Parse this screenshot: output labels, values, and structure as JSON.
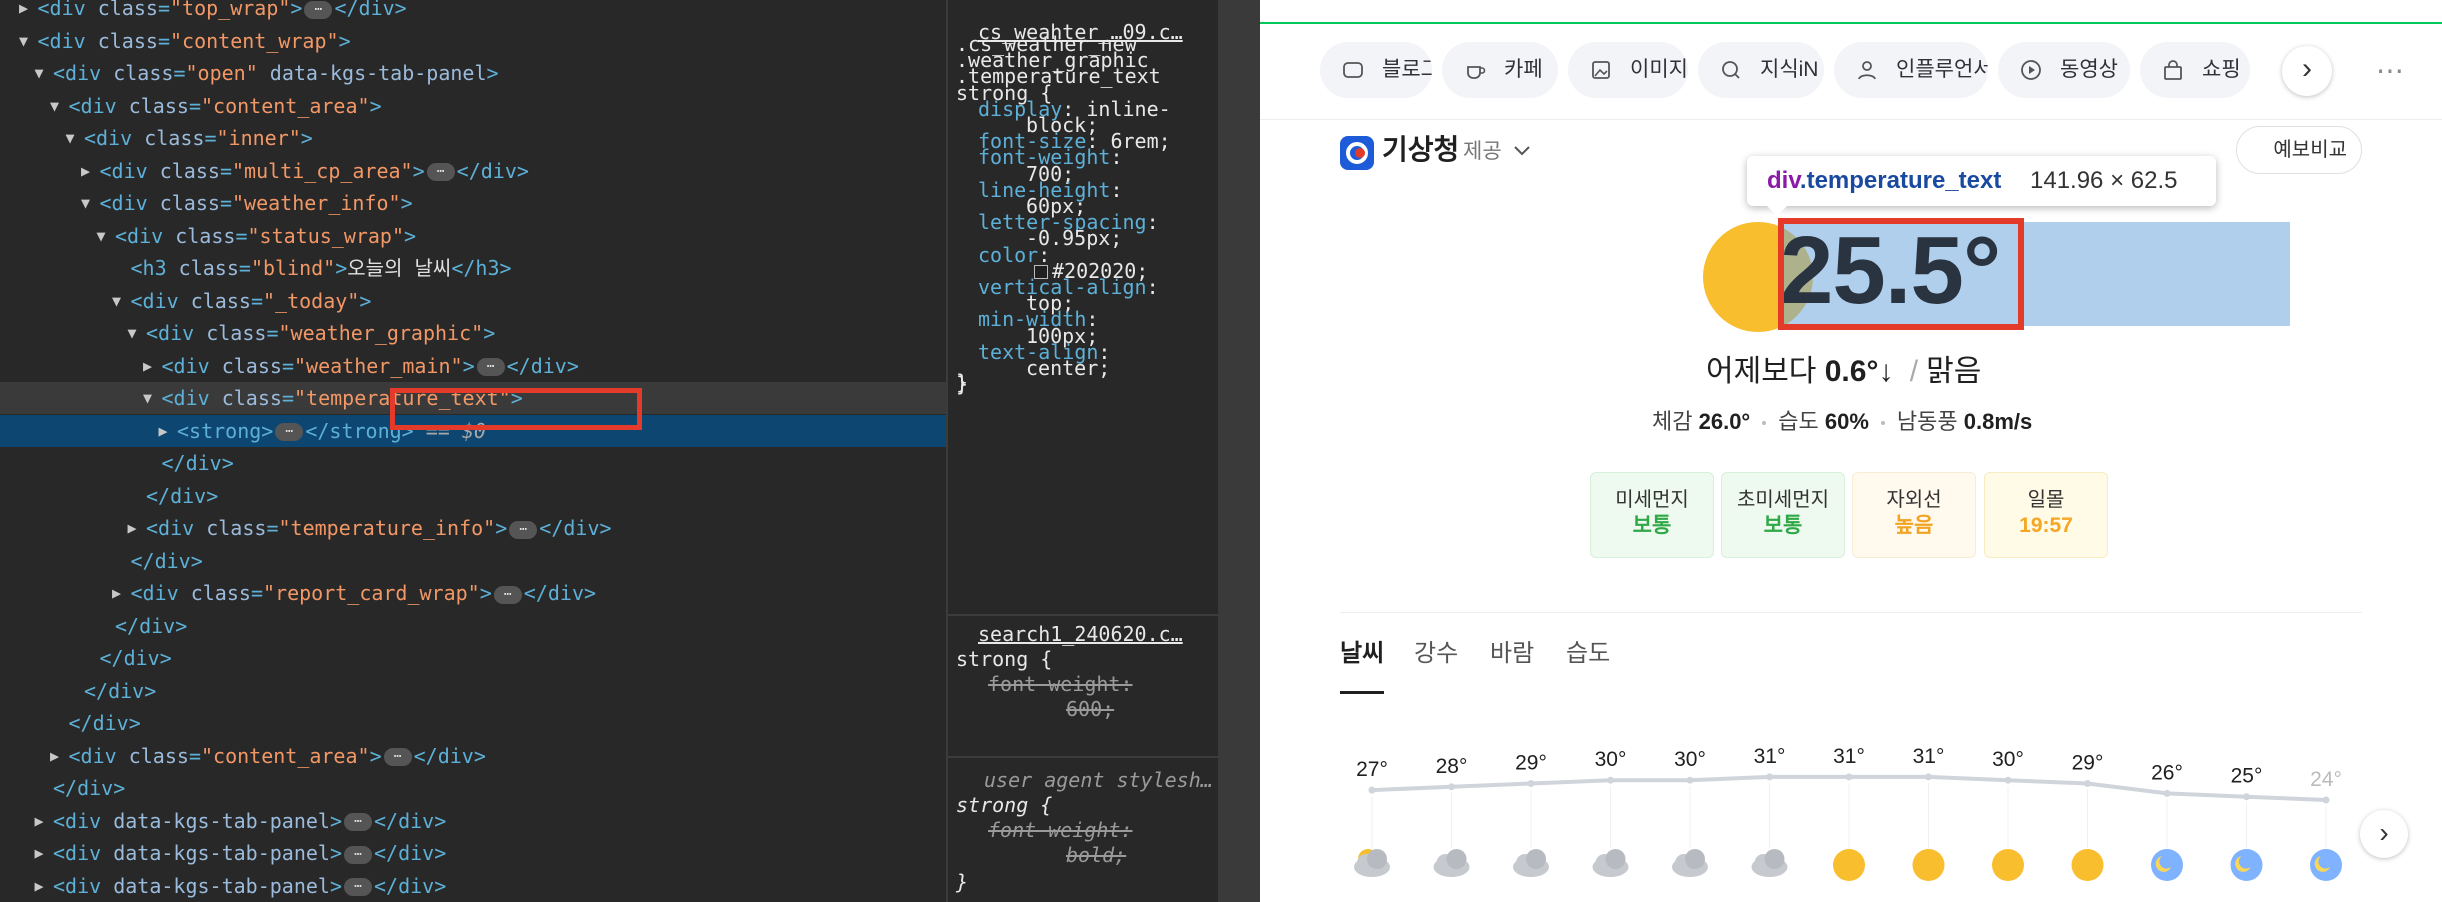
{
  "devtools": {
    "lines": [
      {
        "d": 1,
        "t": "c",
        "parts": [
          [
            "tg",
            "<div "
          ],
          [
            "at",
            "class"
          ],
          [
            "tg",
            "="
          ],
          [
            "av",
            "\"top_wrap\""
          ],
          [
            "tg",
            ">"
          ],
          [
            "ell",
            "⋯"
          ],
          [
            "tg",
            "</div>"
          ]
        ]
      },
      {
        "d": 1,
        "t": "o",
        "parts": [
          [
            "tg",
            "<div "
          ],
          [
            "at",
            "class"
          ],
          [
            "tg",
            "="
          ],
          [
            "av",
            "\"content_wrap\""
          ],
          [
            "tg",
            ">"
          ]
        ]
      },
      {
        "d": 2,
        "t": "o",
        "parts": [
          [
            "tg",
            "<div "
          ],
          [
            "at",
            "class"
          ],
          [
            "tg",
            "="
          ],
          [
            "av",
            "\"open\""
          ],
          [
            "at",
            " data-kgs-tab-panel"
          ],
          [
            "tg",
            ">"
          ]
        ]
      },
      {
        "d": 3,
        "t": "o",
        "parts": [
          [
            "tg",
            "<div "
          ],
          [
            "at",
            "class"
          ],
          [
            "tg",
            "="
          ],
          [
            "av",
            "\"content_area\""
          ],
          [
            "tg",
            ">"
          ]
        ]
      },
      {
        "d": 4,
        "t": "o",
        "parts": [
          [
            "tg",
            "<div "
          ],
          [
            "at",
            "class"
          ],
          [
            "tg",
            "="
          ],
          [
            "av",
            "\"inner\""
          ],
          [
            "tg",
            ">"
          ]
        ]
      },
      {
        "d": 5,
        "t": "c",
        "parts": [
          [
            "tg",
            "<div "
          ],
          [
            "at",
            "class"
          ],
          [
            "tg",
            "="
          ],
          [
            "av",
            "\"multi_cp_area\""
          ],
          [
            "tg",
            ">"
          ],
          [
            "ell",
            "⋯"
          ],
          [
            "tg",
            "</div>"
          ]
        ]
      },
      {
        "d": 5,
        "t": "o",
        "parts": [
          [
            "tg",
            "<div "
          ],
          [
            "at",
            "class"
          ],
          [
            "tg",
            "="
          ],
          [
            "av",
            "\"weather_info\""
          ],
          [
            "tg",
            ">"
          ]
        ]
      },
      {
        "d": 6,
        "t": "o",
        "parts": [
          [
            "tg",
            "<div "
          ],
          [
            "at",
            "class"
          ],
          [
            "tg",
            "="
          ],
          [
            "av",
            "\"status_wrap\""
          ],
          [
            "tg",
            ">"
          ]
        ]
      },
      {
        "d": 7,
        "t": "n",
        "parts": [
          [
            "tg",
            "<h3 "
          ],
          [
            "at",
            "class"
          ],
          [
            "tg",
            "="
          ],
          [
            "av",
            "\"blind\""
          ],
          [
            "tg",
            ">"
          ],
          [
            "tx",
            "오늘의 날씨"
          ],
          [
            "tg",
            "</h3>"
          ]
        ]
      },
      {
        "d": 7,
        "t": "o",
        "parts": [
          [
            "tg",
            "<div "
          ],
          [
            "at",
            "class"
          ],
          [
            "tg",
            "="
          ],
          [
            "av",
            "\"_today\""
          ],
          [
            "tg",
            ">"
          ]
        ]
      },
      {
        "d": 8,
        "t": "o",
        "parts": [
          [
            "tg",
            "<div "
          ],
          [
            "at",
            "class"
          ],
          [
            "tg",
            "="
          ],
          [
            "av",
            "\"weather_graphic\""
          ],
          [
            "tg",
            ">"
          ]
        ]
      },
      {
        "d": 9,
        "t": "c",
        "parts": [
          [
            "tg",
            "<div "
          ],
          [
            "at",
            "class"
          ],
          [
            "tg",
            "="
          ],
          [
            "av",
            "\"weather_main\""
          ],
          [
            "tg",
            ">"
          ],
          [
            "ell",
            "⋯"
          ],
          [
            "tg",
            "</div>"
          ]
        ]
      },
      {
        "d": 9,
        "t": "o",
        "h": "hov",
        "parts": [
          [
            "tg",
            "<div "
          ],
          [
            "at",
            "class"
          ],
          [
            "tg",
            "="
          ],
          [
            "av",
            "\"temperature_text\""
          ],
          [
            "tg",
            ">"
          ]
        ]
      },
      {
        "d": 10,
        "t": "c",
        "h": "sel",
        "parts": [
          [
            "tg",
            "<strong>"
          ],
          [
            "ell",
            "⋯"
          ],
          [
            "tg",
            "</strong>"
          ],
          [
            "zero",
            " == $0"
          ]
        ]
      },
      {
        "d": 9,
        "t": "n",
        "parts": [
          [
            "tg",
            "</div>"
          ]
        ]
      },
      {
        "d": 8,
        "t": "n",
        "parts": [
          [
            "tg",
            "</div>"
          ]
        ]
      },
      {
        "d": 8,
        "t": "c",
        "parts": [
          [
            "tg",
            "<div "
          ],
          [
            "at",
            "class"
          ],
          [
            "tg",
            "="
          ],
          [
            "av",
            "\"temperature_info\""
          ],
          [
            "tg",
            ">"
          ],
          [
            "ell",
            "⋯"
          ],
          [
            "tg",
            "</div>"
          ]
        ]
      },
      {
        "d": 7,
        "t": "n",
        "parts": [
          [
            "tg",
            "</div>"
          ]
        ]
      },
      {
        "d": 7,
        "t": "c",
        "parts": [
          [
            "tg",
            "<div "
          ],
          [
            "at",
            "class"
          ],
          [
            "tg",
            "="
          ],
          [
            "av",
            "\"report_card_wrap\""
          ],
          [
            "tg",
            ">"
          ],
          [
            "ell",
            "⋯"
          ],
          [
            "tg",
            "</div>"
          ]
        ]
      },
      {
        "d": 6,
        "t": "n",
        "parts": [
          [
            "tg",
            "</div>"
          ]
        ]
      },
      {
        "d": 5,
        "t": "n",
        "parts": [
          [
            "tg",
            "</div>"
          ]
        ]
      },
      {
        "d": 4,
        "t": "n",
        "parts": [
          [
            "tg",
            "</div>"
          ]
        ]
      },
      {
        "d": 3,
        "t": "n",
        "parts": [
          [
            "tg",
            "</div>"
          ]
        ]
      },
      {
        "d": 3,
        "t": "c",
        "parts": [
          [
            "tg",
            "<div "
          ],
          [
            "at",
            "class"
          ],
          [
            "tg",
            "="
          ],
          [
            "av",
            "\"content_area\""
          ],
          [
            "tg",
            ">"
          ],
          [
            "ell",
            "⋯"
          ],
          [
            "tg",
            "</div>"
          ]
        ]
      },
      {
        "d": 2,
        "t": "n",
        "parts": [
          [
            "tg",
            "</div>"
          ]
        ]
      },
      {
        "d": 2,
        "t": "c",
        "parts": [
          [
            "tg",
            "<div "
          ],
          [
            "at",
            "data-kgs-tab-panel"
          ],
          [
            "tg",
            ">"
          ],
          [
            "ell",
            "⋯"
          ],
          [
            "tg",
            "</div>"
          ]
        ]
      },
      {
        "d": 2,
        "t": "c",
        "parts": [
          [
            "tg",
            "<div "
          ],
          [
            "at",
            "data-kgs-tab-panel"
          ],
          [
            "tg",
            ">"
          ],
          [
            "ell",
            "⋯"
          ],
          [
            "tg",
            "</div>"
          ]
        ]
      },
      {
        "d": 2,
        "t": "c",
        "parts": [
          [
            "tg",
            "<div "
          ],
          [
            "at",
            "data-kgs-tab-panel"
          ],
          [
            "tg",
            ">"
          ],
          [
            "ell",
            "⋯"
          ],
          [
            "tg",
            "</div>"
          ]
        ]
      }
    ]
  },
  "styles": {
    "src1": "cs_weahter_…09.c…",
    "sel1": [
      ".cs_weather_new",
      ".weather_graphic",
      ".temperature_text",
      "strong {"
    ],
    "decls1": [
      [
        "display",
        "inline-"
      ],
      [
        "",
        "block;"
      ],
      [
        "font-size",
        "6rem;"
      ],
      [
        "font-weight",
        ""
      ],
      [
        "",
        "700;"
      ],
      [
        "line-height",
        ""
      ],
      [
        "",
        "60px;"
      ],
      [
        "letter-spacing",
        ""
      ],
      [
        "",
        "-0.95px;"
      ],
      [
        "color",
        ""
      ],
      [
        "",
        "#202020;"
      ],
      [
        "vertical-align",
        ""
      ],
      [
        "",
        "top;"
      ],
      [
        "min-width",
        ""
      ],
      [
        "",
        "100px;"
      ],
      [
        "text-align",
        ""
      ],
      [
        "",
        "center;"
      ]
    ],
    "close": "}",
    "src2": "search1_240620.c…",
    "sel2": "strong {",
    "decl2a": "font-weight:",
    "decl2b": "600;",
    "ua": "user agent stylesh…",
    "sel3": "strong {",
    "decl3a": "font-weight:",
    "decl3b": "bold;"
  },
  "web": {
    "tabs": [
      "블로그",
      "카페",
      "이미지",
      "지식iN",
      "인플루언서",
      "동영상",
      "쇼핑"
    ],
    "more": "⋯",
    "next": "›",
    "kma": {
      "name": "기상청",
      "provider": "제공"
    },
    "compare_btn": "예보비교",
    "tooltip": {
      "tag": "div",
      "cls": ".temperature_text",
      "dims": "141.96 × 62.5"
    },
    "temperature": "25.5°",
    "compare": {
      "pre": "어제보다",
      "val": "0.6°",
      "arrow": "↓",
      "sep": "/",
      "cond": "맑음"
    },
    "details": [
      {
        "k": "체감",
        "v": "26.0°"
      },
      {
        "k": "습도",
        "v": "60%"
      },
      {
        "k": "남동풍",
        "v": "0.8m/s"
      }
    ],
    "cards": [
      {
        "k": "미세먼지",
        "v": "보통"
      },
      {
        "k": "초미세먼지",
        "v": "보통"
      },
      {
        "k": "자외선",
        "v": "높음"
      },
      {
        "k": "일몰",
        "v": "19:57"
      }
    ],
    "wtabs": [
      "날씨",
      "강수",
      "바람",
      "습도"
    ],
    "hourly": {
      "temps": [
        27,
        28,
        29,
        30,
        30,
        31,
        31,
        31,
        30,
        29,
        26,
        25,
        24
      ],
      "icons": [
        "partly-sunny",
        "cloudy",
        "cloudy",
        "cloudy",
        "cloudy",
        "cloudy",
        "sunny",
        "sunny",
        "sunny",
        "sunny",
        "night-clear",
        "night-clear",
        "night-clear"
      ]
    }
  }
}
